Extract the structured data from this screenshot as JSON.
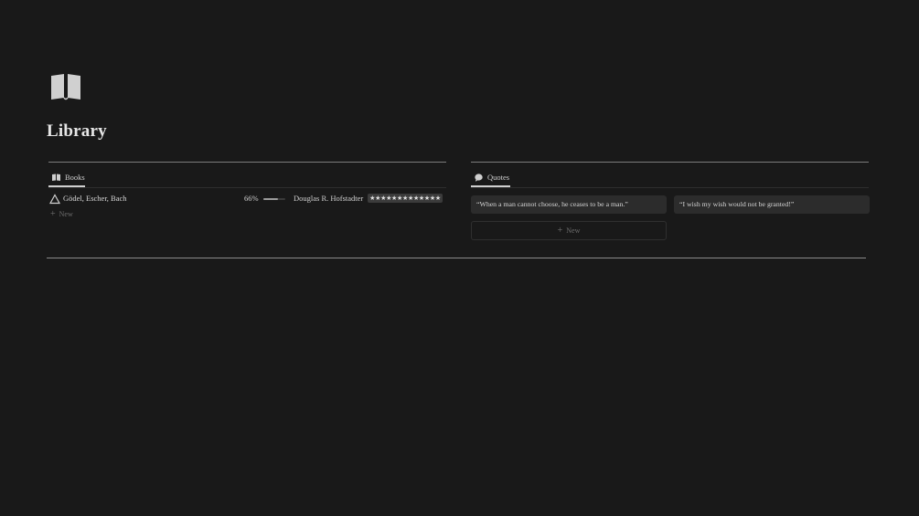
{
  "page": {
    "title": "Library",
    "icon": "open-book-icon"
  },
  "books": {
    "tab_label": "Books",
    "tab_icon": "open-book-icon",
    "rows": [
      {
        "title": "Gödel, Escher, Bach",
        "icon": "triangle-icon",
        "progress_text": "66%",
        "progress_fraction": 0.66,
        "author": "Douglas R. Hofstadter",
        "rating": "★★★★★★★★★★★★★"
      }
    ],
    "new_label": "New"
  },
  "quotes": {
    "tab_label": "Quotes",
    "tab_icon": "speech-bubble-icon",
    "cards": [
      {
        "text": "“When a man cannot choose, he ceases to be a man.”"
      },
      {
        "text": "“I wish my wish would not be granted!”"
      }
    ],
    "new_label": "New"
  },
  "colors": {
    "background": "#191919",
    "card": "#2c2c2c",
    "text": "#d4d4d4"
  }
}
